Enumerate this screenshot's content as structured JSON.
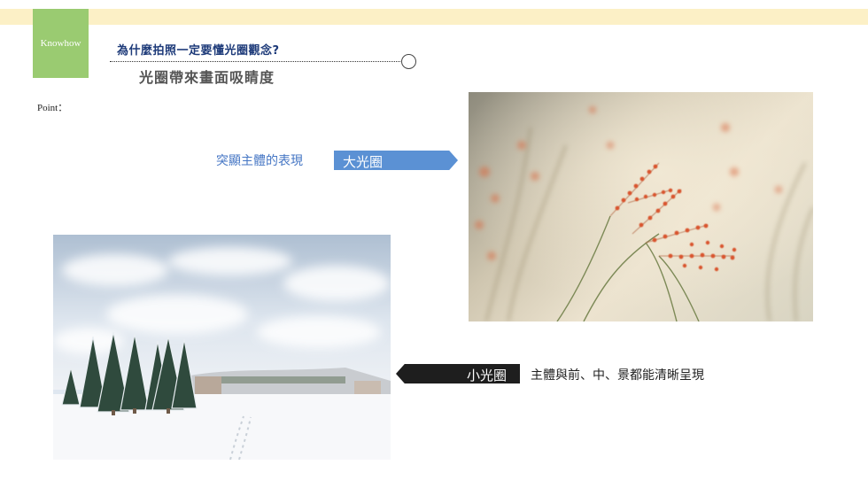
{
  "header": {
    "tag": "Knowhow",
    "question": "為什麼拍照一定要懂光圈觀念?",
    "subtitle": "光圈帶來畫面吸睛度",
    "point_label": "Point："
  },
  "large_aperture": {
    "caption": "突顯主體的表現",
    "label": "大光圈",
    "photo_icon": "grass-bokeh-photo"
  },
  "small_aperture": {
    "label": "小光圈",
    "caption": "主體與前、中、景都能清晰呈現",
    "photo_icon": "snowy-landscape-photo"
  },
  "colors": {
    "band": "#fcf0c6",
    "tag": "#9acb71",
    "title_blue": "#1d3a79",
    "arrow_blue": "#5b91d4",
    "arrow_dark": "#1e1e1e"
  }
}
